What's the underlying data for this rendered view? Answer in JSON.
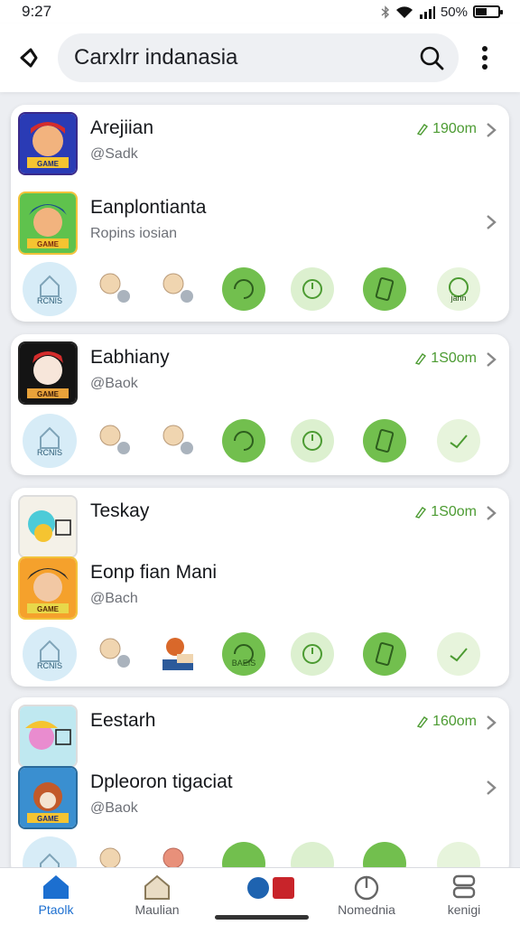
{
  "status": {
    "time": "9:27",
    "battery": "50%",
    "battery_level": 0.5
  },
  "header": {
    "search_value": "Carxlrr indanasia",
    "back_icon": "back-chevron-icon",
    "search_icon": "search-icon",
    "more_icon": "more-vertical-icon"
  },
  "cards": [
    {
      "apps": [
        {
          "title": "Arejiian",
          "subtitle": "@Sadk",
          "size": "190om",
          "icon": "game-boy-red-cap-icon"
        },
        {
          "title": "Eanplontianta",
          "subtitle": "Ropins iosian",
          "size": "",
          "icon": "game-boy-blue-hat-icon"
        }
      ],
      "tools": {
        "home_label": "RCNIS",
        "labels": [
          "",
          "",
          "",
          "",
          "",
          "",
          "jarin"
        ]
      }
    },
    {
      "apps": [
        {
          "title": "Eabhiany",
          "subtitle": "@Baok",
          "size": "1S0om",
          "icon": "game-hero-red-cap-icon"
        }
      ],
      "tools": {
        "home_label": "RCNIS",
        "labels": [
          "",
          "",
          "",
          "",
          "",
          "",
          ""
        ]
      }
    },
    {
      "apps": [
        {
          "title": "Teskay",
          "subtitle": "",
          "size": "1S0om",
          "icon": "game-cyan-character-icon"
        },
        {
          "title": "Eonp fian Mani",
          "subtitle": "@Bach",
          "size": "",
          "icon": "game-pirate-icon"
        }
      ],
      "tools": {
        "home_label": "RCNIS",
        "labels": [
          "",
          "",
          "",
          "BAEIS",
          "",
          "",
          ""
        ]
      }
    },
    {
      "apps": [
        {
          "title": "Eestarh",
          "subtitle": "",
          "size": "160om",
          "icon": "game-pink-character-icon"
        },
        {
          "title": "Dpleoron tigaciat",
          "subtitle": "@Baok",
          "size": "",
          "icon": "game-dog-hero-icon"
        }
      ],
      "tools": {
        "home_label": "",
        "labels": [
          "",
          "",
          "",
          "",
          "",
          "",
          ""
        ]
      }
    }
  ],
  "nav": [
    {
      "label": "Ptaolk",
      "icon": "home-icon",
      "active": true
    },
    {
      "label": "Maulian",
      "icon": "house-outline-icon",
      "active": false
    },
    {
      "label": "",
      "icon": "app-logo-icon",
      "active": false
    },
    {
      "label": "Nomednia",
      "icon": "power-icon",
      "active": false
    },
    {
      "label": "kenigi",
      "icon": "storage-icon",
      "active": false
    }
  ],
  "colors": {
    "accent_blue": "#1c6fd0",
    "accent_green": "#4c9b32",
    "card_bg": "#ffffff",
    "page_bg": "#eceef2"
  }
}
